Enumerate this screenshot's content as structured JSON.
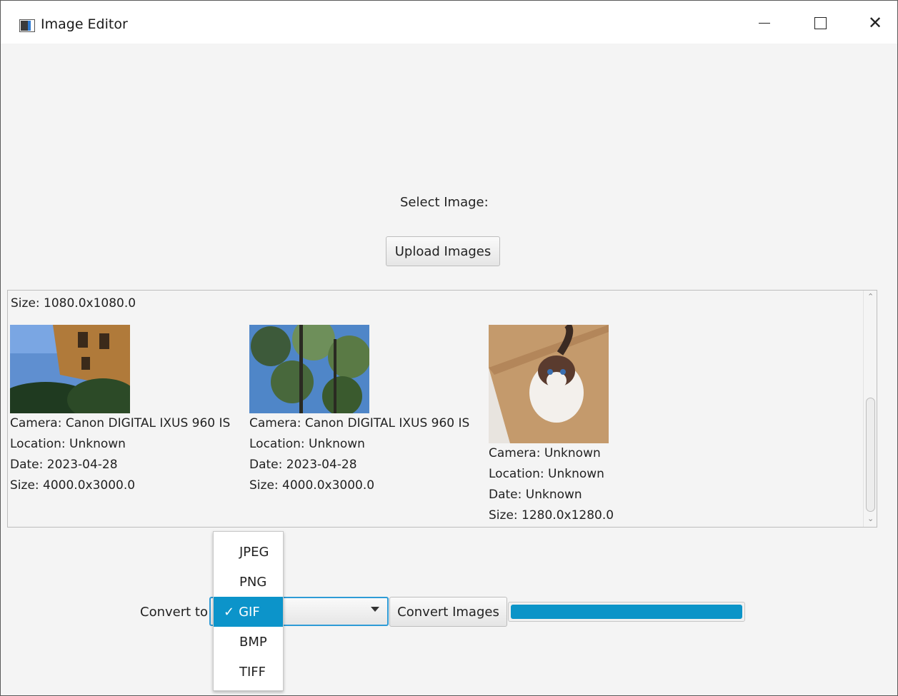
{
  "window": {
    "title": "Image Editor",
    "min_icon": "minimize-icon",
    "max_icon": "maximize-icon",
    "close_icon": "close-icon"
  },
  "main": {
    "select_label": "Select Image:",
    "upload_label": "Upload Images"
  },
  "gallery": {
    "top_partial_size": "Size: 1080.0x1080.0",
    "items": [
      {
        "camera": "Camera: Canon DIGITAL IXUS 960 IS",
        "location": "Location: Unknown",
        "date": "Date: 2023-04-28",
        "size": "Size: 4000.0x3000.0"
      },
      {
        "camera": "Camera: Canon DIGITAL IXUS 960 IS",
        "location": "Location: Unknown",
        "date": "Date: 2023-04-28",
        "size": "Size: 4000.0x3000.0"
      },
      {
        "camera": "Camera: Unknown",
        "location": "Location: Unknown",
        "date": "Date: Unknown",
        "size": "Size: 1280.0x1280.0"
      }
    ]
  },
  "convert": {
    "label": "Convert to:",
    "selected": "GIF",
    "options": [
      "JPEG",
      "PNG",
      "GIF",
      "BMP",
      "TIFF"
    ],
    "button_label": "Convert Images",
    "progress": 1.0,
    "check_glyph": "✓"
  },
  "colors": {
    "accent": "#0c94ca",
    "focus": "#2e9bd6"
  }
}
